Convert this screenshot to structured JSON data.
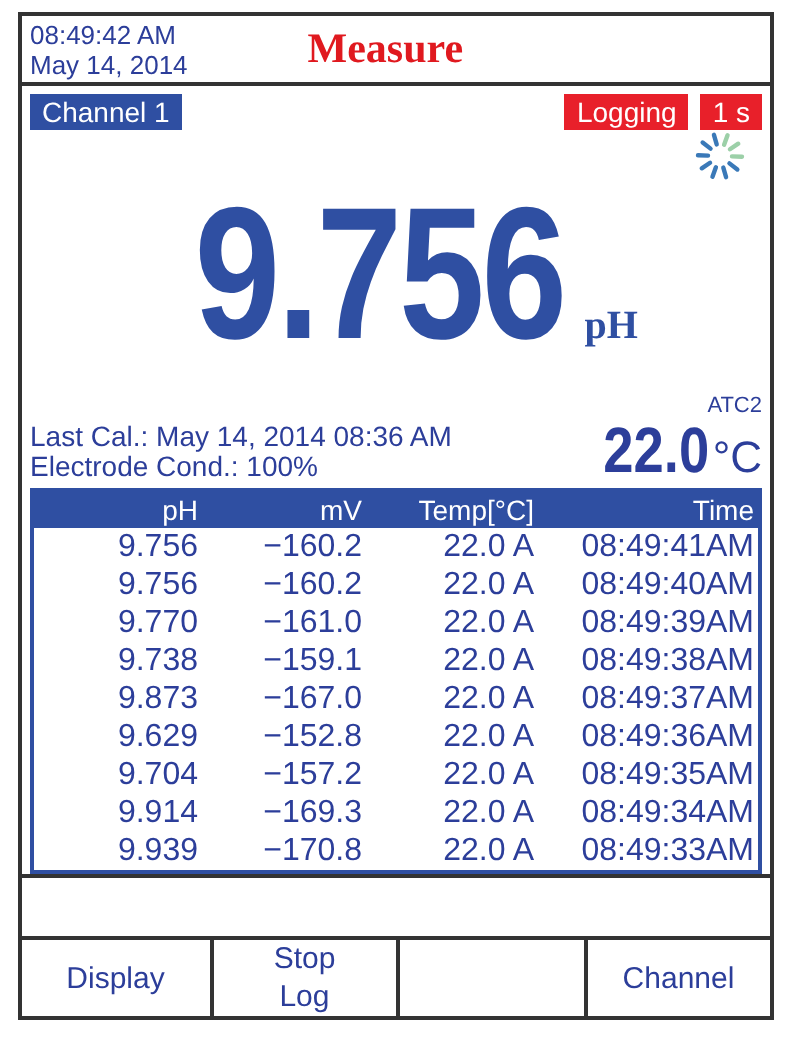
{
  "header": {
    "time": "08:49:42 AM",
    "date": "May 14, 2014",
    "title": "Measure"
  },
  "status": {
    "channel": "Channel  1",
    "logging": "Logging",
    "interval": "1 s"
  },
  "reading": {
    "value": "9.756",
    "unit": "pH"
  },
  "info": {
    "last_cal": "Last Cal.: May 14, 2014 08:36 AM",
    "electrode": "Electrode Cond.: 100%",
    "probe": "ATC2",
    "temperature": "22.0",
    "temp_unit": "°C"
  },
  "table": {
    "columns": [
      "pH",
      "mV",
      "Temp[°C]",
      "Time"
    ],
    "rows": [
      [
        "9.756",
        "−160.2",
        "22.0 A",
        "08:49:41AM"
      ],
      [
        "9.756",
        "−160.2",
        "22.0 A",
        "08:49:40AM"
      ],
      [
        "9.770",
        "−161.0",
        "22.0 A",
        "08:49:39AM"
      ],
      [
        "9.738",
        "−159.1",
        "22.0 A",
        "08:49:38AM"
      ],
      [
        "9.873",
        "−167.0",
        "22.0 A",
        "08:49:37AM"
      ],
      [
        "9.629",
        "−152.8",
        "22.0 A",
        "08:49:36AM"
      ],
      [
        "9.704",
        "−157.2",
        "22.0 A",
        "08:49:35AM"
      ],
      [
        "9.914",
        "−169.3",
        "22.0 A",
        "08:49:34AM"
      ],
      [
        "9.939",
        "−170.8",
        "22.0 A",
        "08:49:33AM"
      ]
    ]
  },
  "softkeys": [
    {
      "kind": "key",
      "label": "Display"
    },
    {
      "kind": "key",
      "label": "Stop Log"
    },
    {
      "kind": "blank"
    },
    {
      "kind": "key",
      "label": "Channel"
    }
  ]
}
